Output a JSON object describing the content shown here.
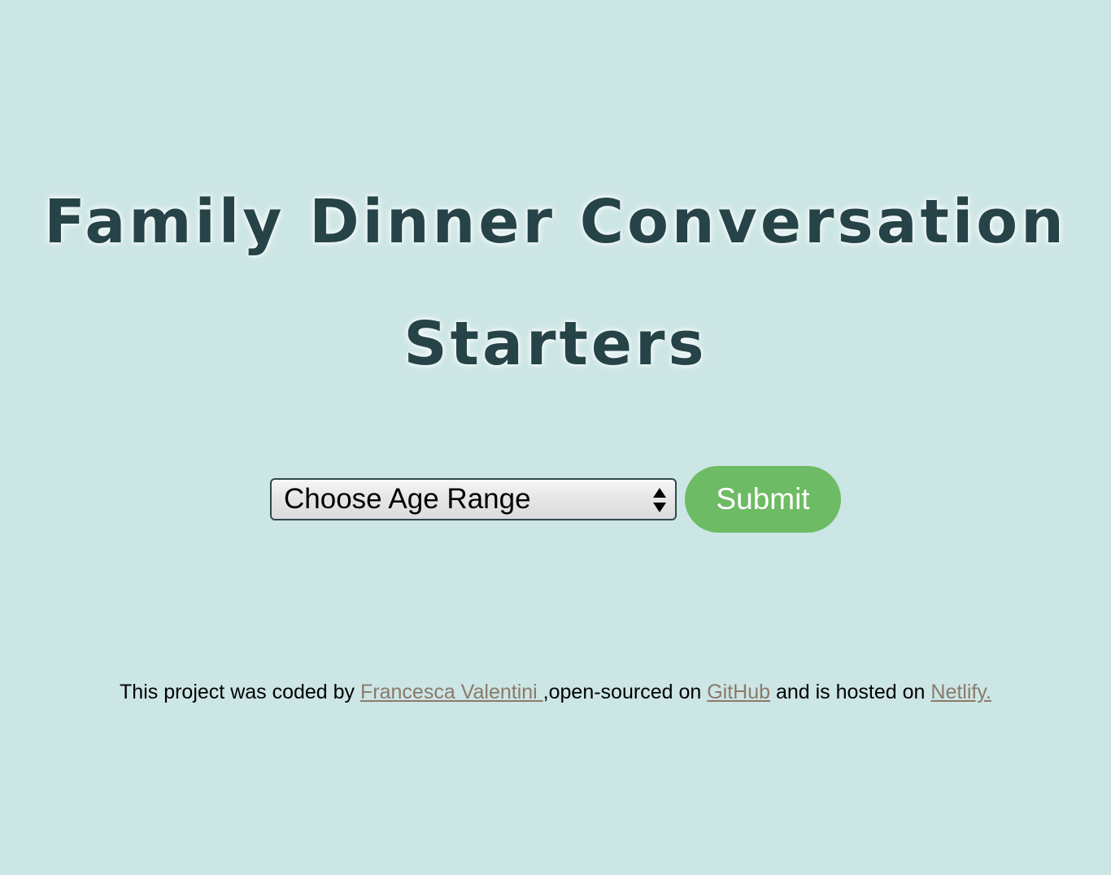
{
  "header": {
    "title": "Family Dinner Conversation Starters"
  },
  "form": {
    "age_select": {
      "selected": "Choose Age Range"
    },
    "submit_label": "Submit"
  },
  "footer": {
    "text_before_author": "This project was coded by ",
    "author_link": "Francesca Valentini ",
    "text_after_author": ",open-sourced on ",
    "github_link": "GitHub",
    "text_after_github": " and is hosted on ",
    "netlify_link": "Netlify."
  },
  "colors": {
    "background": "#cce5e5",
    "title_text": "#264448",
    "submit_button": "#6dbb64",
    "link": "#8a7a6a"
  },
  "icons": {
    "select_arrows": "up-down-arrows-icon"
  }
}
